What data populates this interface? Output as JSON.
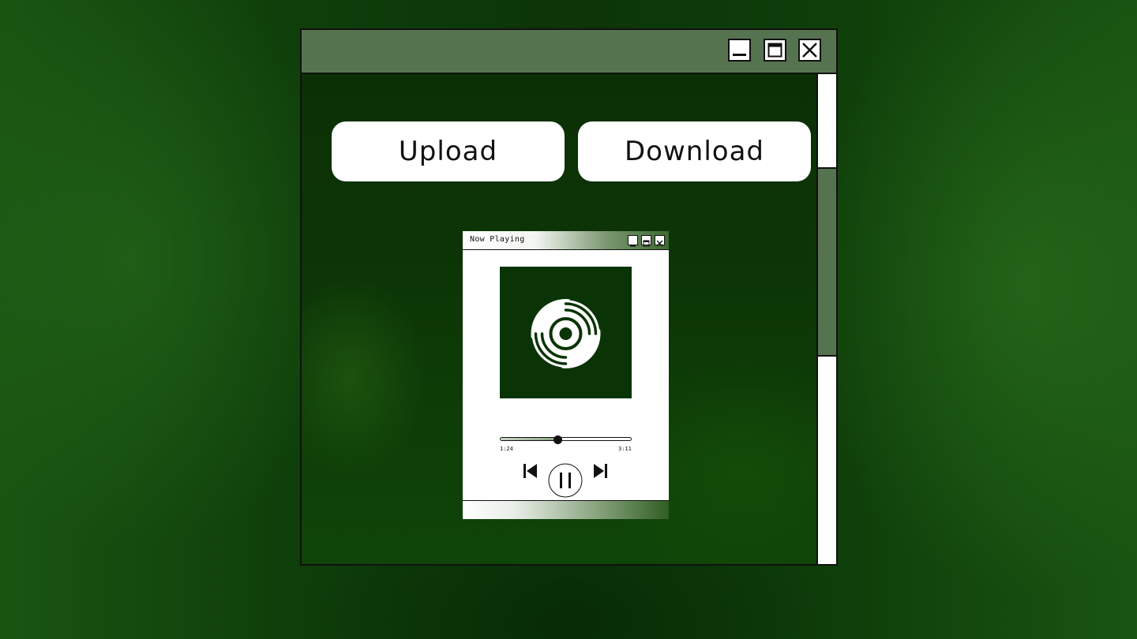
{
  "window": {
    "controls": {
      "minimize_icon": "minimize-icon",
      "maximize_icon": "maximize-icon",
      "close_icon": "close-icon"
    }
  },
  "actions": {
    "upload_label": "Upload",
    "download_label": "Download"
  },
  "player": {
    "title": "Now Playing",
    "album_icon": "vinyl-record-icon",
    "elapsed": "1:24",
    "duration": "3:11",
    "progress": 0.44,
    "controls": {
      "previous_icon": "skip-previous-icon",
      "play_pause_icon": "pause-icon",
      "next_icon": "skip-next-icon"
    }
  },
  "colors": {
    "titlebar": "#567350",
    "album_bg": "#0a3405",
    "accent_dark": "#111111"
  }
}
